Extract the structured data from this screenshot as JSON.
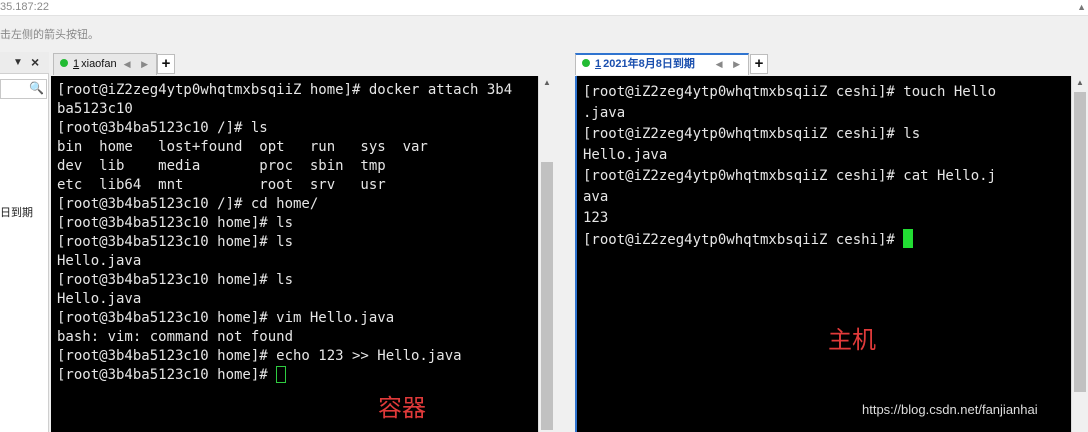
{
  "topbar": {
    "address": "35.187:22",
    "scroll_arrow": "▲"
  },
  "hint": {
    "text": "击左侧的箭头按钮。"
  },
  "left_panel": {
    "pin": "▼",
    "close": "×",
    "search_icon": "🔍",
    "item": "日到期"
  },
  "tabs_left": {
    "num": "1",
    "label": "xiaofan",
    "nav": "◀ ▶",
    "add": "+"
  },
  "tabs_right": {
    "num": "1",
    "label": "2021年8月8日到期",
    "nav": "◀ ▶",
    "add": "+"
  },
  "terminal_left": {
    "lines": [
      "[root@iZ2zeg4ytp0whqtmxbsqiiZ home]# docker attach 3b4",
      "ba5123c10",
      "[root@3b4ba5123c10 /]# ls",
      "bin  home   lost+found  opt   run   sys  var",
      "dev  lib    media       proc  sbin  tmp",
      "etc  lib64  mnt         root  srv   usr",
      "[root@3b4ba5123c10 /]# cd home/",
      "[root@3b4ba5123c10 home]# ls",
      "[root@3b4ba5123c10 home]# ls",
      "Hello.java",
      "[root@3b4ba5123c10 home]# ls",
      "Hello.java",
      "[root@3b4ba5123c10 home]# vim Hello.java",
      "bash: vim: command not found",
      "[root@3b4ba5123c10 home]# echo 123 >> Hello.java"
    ],
    "prompt": "[root@3b4ba5123c10 home]# "
  },
  "terminal_right": {
    "lines": [
      "[root@iZ2zeg4ytp0whqtmxbsqiiZ ceshi]# touch Hello",
      ".java",
      "[root@iZ2zeg4ytp0whqtmxbsqiiZ ceshi]# ls",
      "Hello.java",
      "[root@iZ2zeg4ytp0whqtmxbsqiiZ ceshi]# cat Hello.j",
      "ava",
      "123"
    ],
    "prompt": "[root@iZ2zeg4ytp0whqtmxbsqiiZ ceshi]# "
  },
  "scroll_arrow": "▲",
  "captions": {
    "container": "容器",
    "host": "主机"
  },
  "watermark": "https://blog.csdn.net/fanjianhai",
  "colors": {
    "terminal_bg": "#000000",
    "terminal_fg": "#e6e6e6",
    "cursor": "#22dd33",
    "caption": "#e03a3a",
    "accent": "#2f74d0"
  }
}
